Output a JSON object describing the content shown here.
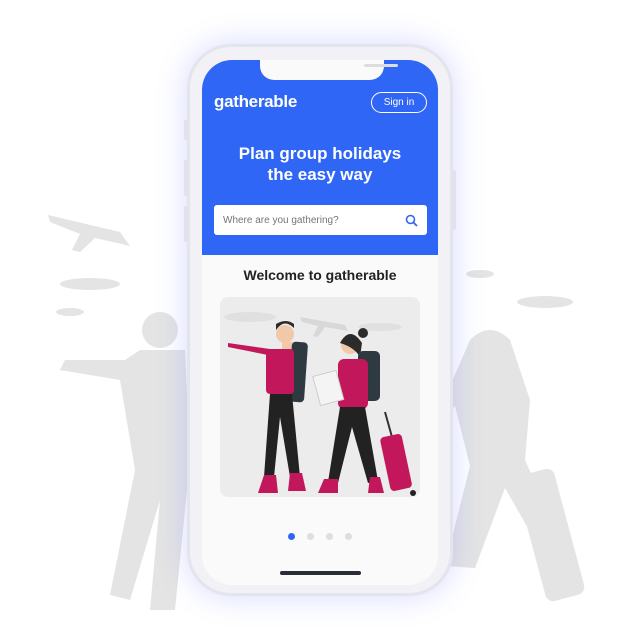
{
  "header": {
    "logo": "gatherable",
    "sign_in_label": "Sign in",
    "hero_line1": "Plan group holidays",
    "hero_line2": "the easy way"
  },
  "search": {
    "placeholder": "Where are you gathering?",
    "icon": "search-icon"
  },
  "main": {
    "welcome": "Welcome to gatherable"
  },
  "carousel": {
    "total": 4,
    "active": 1
  },
  "colors": {
    "brand": "#2f66f5",
    "accent": "#c2185b"
  }
}
